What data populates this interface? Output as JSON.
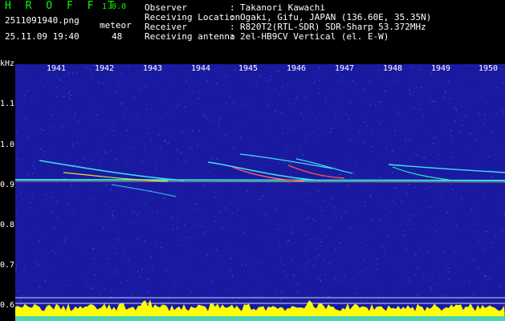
{
  "header": {
    "brand": "H R O F F T",
    "version": "1.0.0",
    "filename": "2511091940.png",
    "datetime": "25.11.09 19:40",
    "meteor_label": "meteor",
    "meteor_count": "48",
    "info": [
      {
        "label": "Observer",
        "value": "Takanori Kawachi"
      },
      {
        "label": "Receiving Location",
        "value": "Ogaki, Gifu, JAPAN (136.60E, 35.35N)"
      },
      {
        "label": "Receiver",
        "value": "R820T2(RTL-SDR) SDR-Sharp 53.372MHz"
      },
      {
        "label": "Receiving antenna",
        "value": "2el-HB9CV Vertical (el. E-W)"
      }
    ]
  },
  "axes": {
    "y_unit": "kHz",
    "y_ticks": [
      "1.1",
      "1.0",
      "0.9",
      "0.8",
      "0.7",
      "0.6"
    ],
    "x_ticks": [
      "1941",
      "1942",
      "1943",
      "1944",
      "1945",
      "1946",
      "1947",
      "1948",
      "1949",
      "1950"
    ]
  },
  "colors": {
    "background": "#1a1aa0",
    "label_green": "#00ff00",
    "signal_yellow": "#ffff00"
  }
}
